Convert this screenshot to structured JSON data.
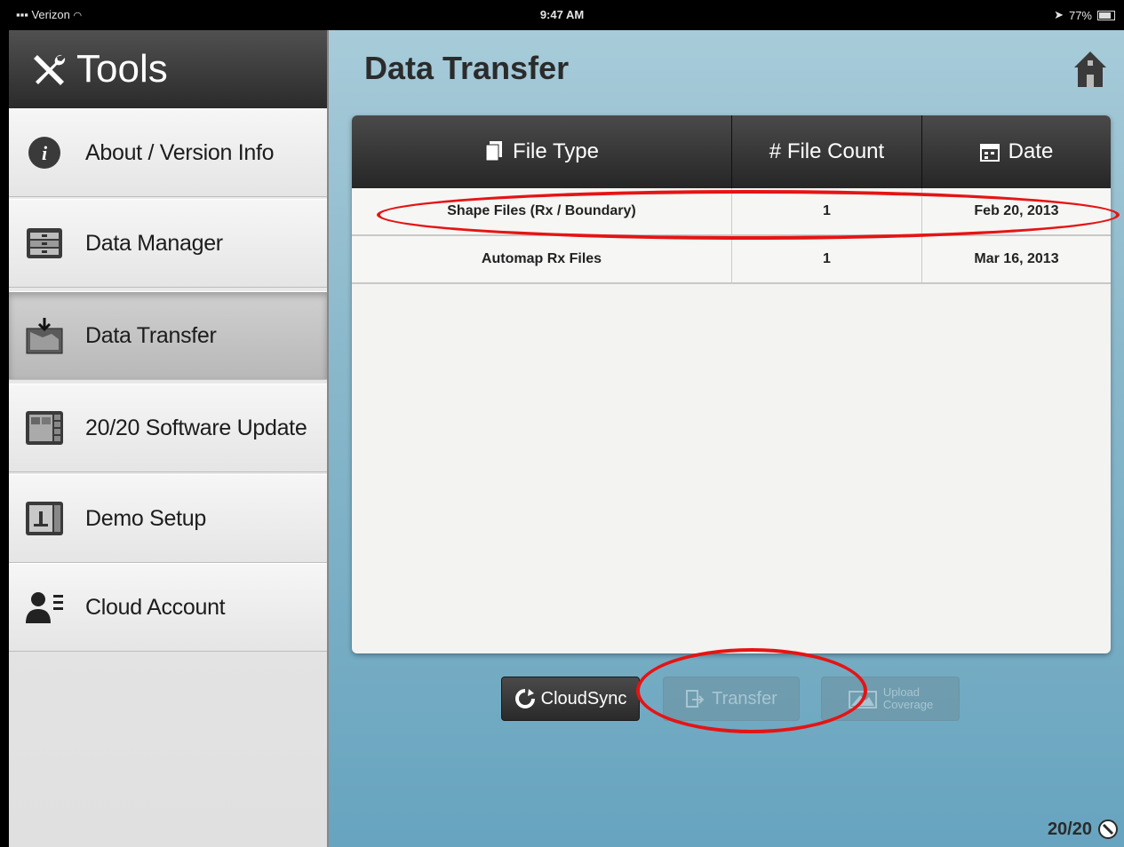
{
  "status_bar": {
    "carrier": "Verizon",
    "time": "9:47 AM",
    "battery": "77%"
  },
  "sidebar": {
    "title": "Tools",
    "items": [
      {
        "label": "About / Version Info",
        "icon": "info-icon"
      },
      {
        "label": "Data Manager",
        "icon": "data-manager-icon"
      },
      {
        "label": "Data Transfer",
        "icon": "data-transfer-icon",
        "active": true
      },
      {
        "label": "20/20 Software Update",
        "icon": "monitor-icon"
      },
      {
        "label": "Demo Setup",
        "icon": "demo-icon"
      },
      {
        "label": "Cloud Account",
        "icon": "user-icon"
      }
    ]
  },
  "main": {
    "title": "Data Transfer",
    "table": {
      "headers": [
        "File Type",
        "# File Count",
        "Date"
      ],
      "rows": [
        {
          "file_type": "Shape Files (Rx / Boundary)",
          "count": "1",
          "date": "Feb 20, 2013"
        },
        {
          "file_type": "Automap Rx Files",
          "count": "1",
          "date": "Mar 16, 2013"
        }
      ]
    },
    "buttons": {
      "cloudsync": "CloudSync",
      "transfer": "Transfer",
      "upload_line1": "Upload",
      "upload_line2": "Coverage"
    },
    "footer_badge": "20/20"
  },
  "colors": {
    "annotation": "#e51414",
    "header": "#2b2b2b",
    "background": "#8ab8cb"
  }
}
